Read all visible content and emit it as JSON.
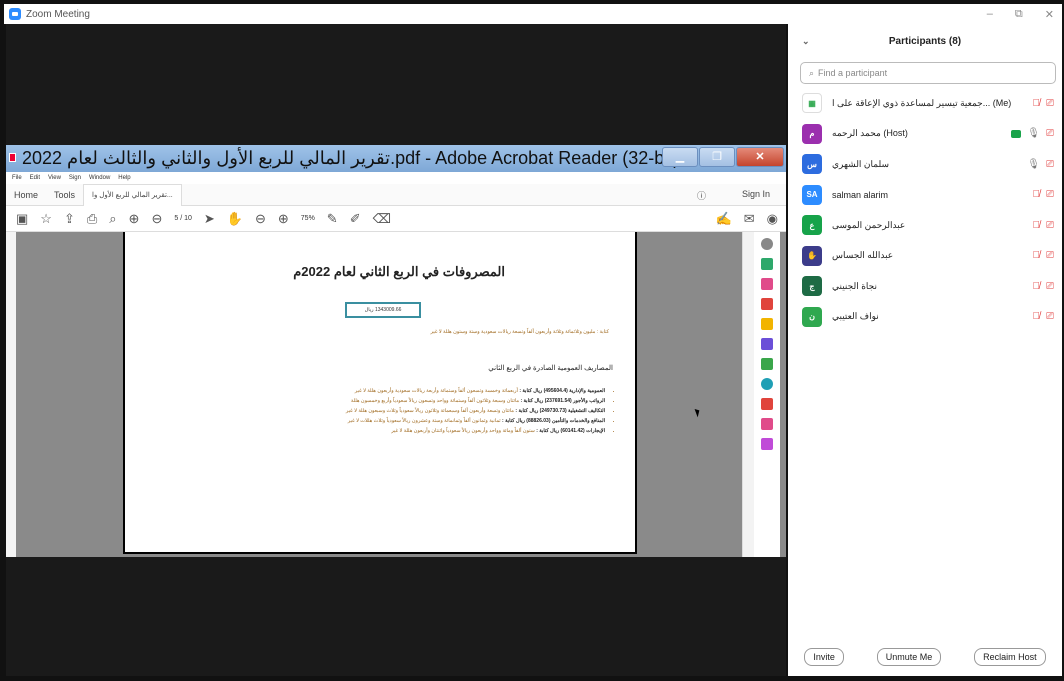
{
  "zoom": {
    "title": "Zoom Meeting",
    "controls": [
      "–",
      "⧉",
      "✕"
    ]
  },
  "acrobat": {
    "window_title": "تقرير المالي للربع الأول والثاني والثالث لعام 2022.pdf - Adobe Acrobat Reader (32-bit)",
    "menu": [
      "File",
      "Edit",
      "View",
      "Sign",
      "Window",
      "Help"
    ],
    "tabs": {
      "home": "Home",
      "tools": "Tools",
      "doc": "تقرير المالي للربع الأول وا..."
    },
    "sign_in": "Sign In",
    "page_indicator": "5 / 10",
    "zoom_value": "75%"
  },
  "pdf": {
    "title": "المصروفات في الربع الثاني لعام 2022م",
    "amount_box": "1343009.66 ريال",
    "note": "كتابة : مليون وثلاثمائة وثلاثة وأربعون ألفاً وتسعة ريالات سعودية وستة وستون هللة لا غير",
    "section": "المصاريف العمومية الصادرة في الربع الثاني",
    "items": [
      {
        "label": "العمومية والإدارية (495604.4) ريال كتابة :",
        "text": "أربعمائة وخمسة وتسعون ألفاً وستمائة وأربعة ريالات سعودية وأربعون هللة لا غير"
      },
      {
        "label": "الرواتب والأجور (237691.54) ريال كتابة :",
        "text": "مائتان وسبعة وثلاثون ألفاً وستمائة وواحد وتسعون ريالاً سعودياً وأربع وخمسون هللة"
      },
      {
        "label": "التكاليف التشغيلية (249730.73) ريال كتابة :",
        "text": "مائتان وتسعة وأربعون ألفاً وسبعمائة وثلاثون ريالاً سعودياً وثلاث وسبعون هللة لا غير"
      },
      {
        "label": "المنافع والخدمات والتأمين (88826.03) ريال كتابة :",
        "text": "ثمانية وثمانون ألفاً وثمانمائة وستة وعشرون ريالاً سعودياً وثلاث هللات لا غير"
      },
      {
        "label": "الإيجارات (60141.42) ريال كتابة :",
        "text": "ستون ألفاً ومائة وواحد وأربعون ريالاً سعودياً واثنتان وأربعون هللة لا غير"
      }
    ]
  },
  "participants": {
    "header": "Participants (8)",
    "search_placeholder": "Find a participant",
    "list": [
      {
        "name": "جمعية تيسير لمساعدة ذوي الإعاقة على ا... (Me)",
        "initials": "",
        "color": "#ffffff",
        "mic": "off",
        "cam": "off"
      },
      {
        "name": "محمد الرحمه (Host)",
        "initials": "م",
        "color": "#9b2fae",
        "mic": "on",
        "cam": "on"
      },
      {
        "name": "سلمان الشهري",
        "initials": "س",
        "color": "#2d6cdf",
        "mic": "on",
        "cam": "off"
      },
      {
        "name": "salman alarim",
        "initials": "SA",
        "color": "#2d8cff",
        "mic": "off",
        "cam": "off"
      },
      {
        "name": "عبدالرحمن الموسى",
        "initials": "ع",
        "color": "#17a34a",
        "mic": "off",
        "cam": "off"
      },
      {
        "name": "عبدالله الجساس",
        "initials": "✋",
        "color": "#3c3c8a",
        "mic": "off",
        "cam": "off"
      },
      {
        "name": "نجاة الجنيني",
        "initials": "ج",
        "color": "#1e6b45",
        "mic": "off",
        "cam": "off"
      },
      {
        "name": "نواف العتيبي",
        "initials": "ن",
        "color": "#2fa84f",
        "mic": "off",
        "cam": "off"
      }
    ],
    "buttons": {
      "invite": "Invite",
      "unmute": "Unmute Me",
      "reclaim": "Reclaim Host"
    }
  }
}
